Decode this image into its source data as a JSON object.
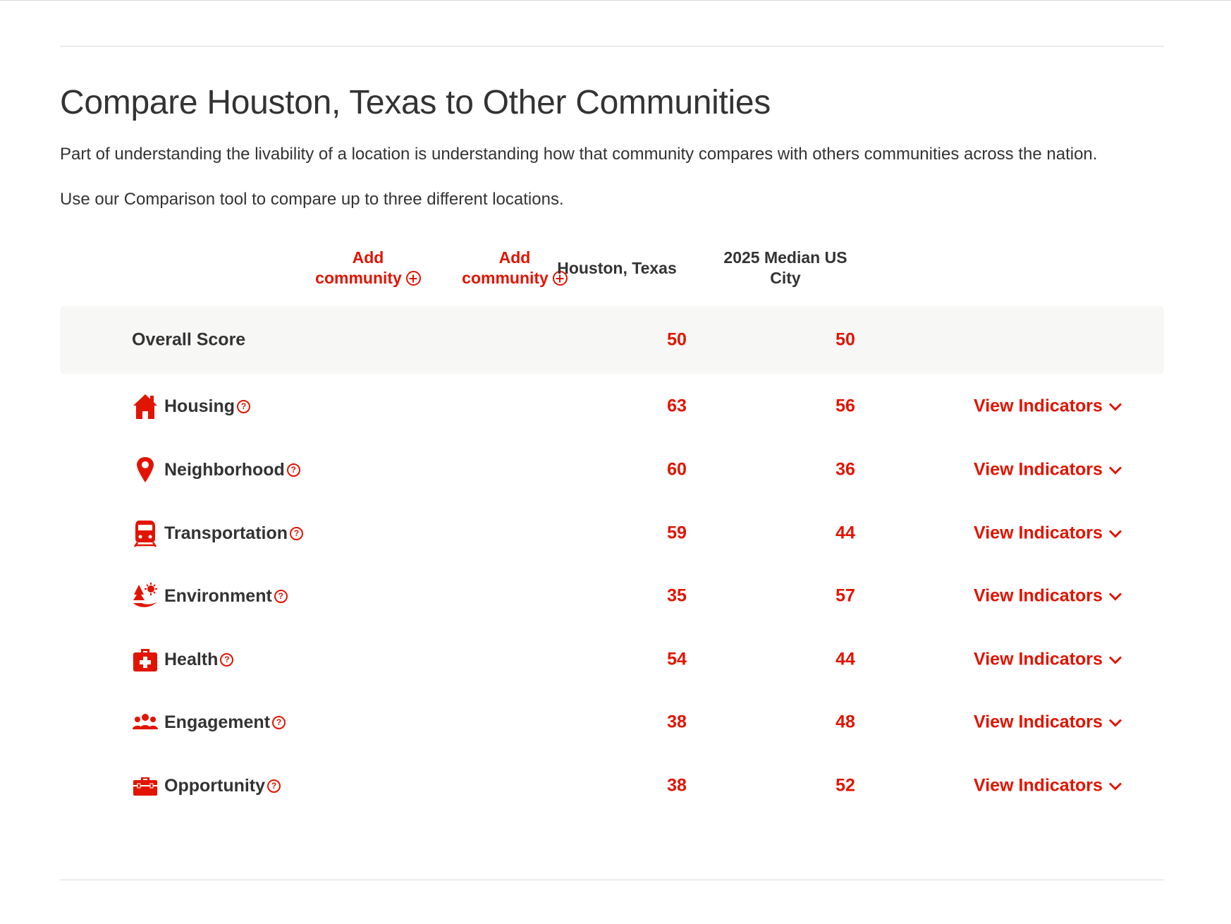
{
  "title": "Compare Houston, Texas to Other Communities",
  "description": "Part of understanding the livability of a location is understanding how that community compares with others communities across the nation.",
  "instruction": "Use our Comparison tool to compare up to three different locations.",
  "columns": {
    "add_1": {
      "line1": "Add",
      "line2": "community"
    },
    "add_2": {
      "line1": "Add",
      "line2": "community"
    },
    "city": "Houston, Texas",
    "median_line1": "2025 Median US",
    "median_line2": "City"
  },
  "overall": {
    "label": "Overall Score",
    "city": "50",
    "median": "50"
  },
  "view_label": "View Indicators",
  "categories": [
    {
      "name": "Housing",
      "icon": "house-icon",
      "city": "63",
      "median": "56"
    },
    {
      "name": "Neighborhood",
      "icon": "location-pin-icon",
      "city": "60",
      "median": "36"
    },
    {
      "name": "Transportation",
      "icon": "train-icon",
      "city": "59",
      "median": "44"
    },
    {
      "name": "Environment",
      "icon": "environment-icon",
      "city": "35",
      "median": "57"
    },
    {
      "name": "Health",
      "icon": "first-aid-kit-icon",
      "city": "54",
      "median": "44"
    },
    {
      "name": "Engagement",
      "icon": "people-group-icon",
      "city": "38",
      "median": "48"
    },
    {
      "name": "Opportunity",
      "icon": "toolbox-icon",
      "city": "38",
      "median": "52"
    }
  ],
  "colors": {
    "accent": "#e11400",
    "text": "#333333",
    "overall_bg": "#f7f7f6"
  }
}
